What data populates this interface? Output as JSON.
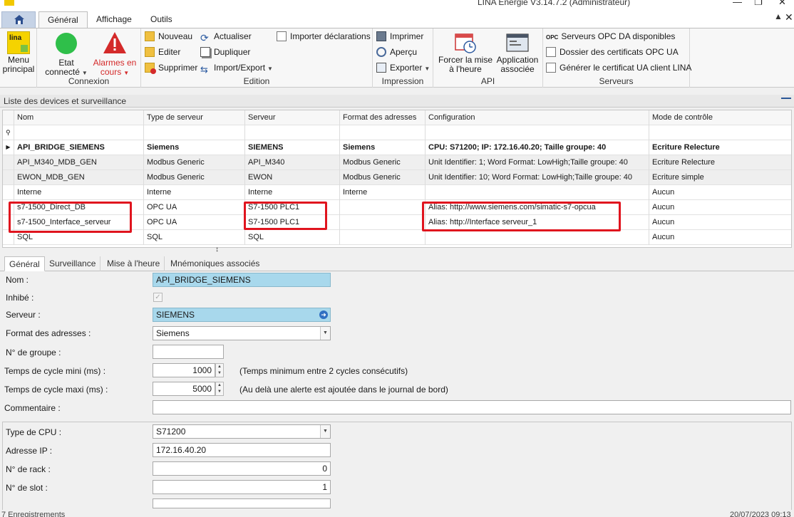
{
  "window": {
    "title": "LINA Energie   V3.14.7.2  (Administrateur)"
  },
  "ribbon_tabs": [
    "Général",
    "Affichage",
    "Outils"
  ],
  "ribbon": {
    "menu": {
      "line1": "Menu",
      "line2": "principal",
      "logo_text": "lina"
    },
    "connexion": {
      "label": "Connexion",
      "etat": {
        "line1": "Etat",
        "line2": "connecté"
      },
      "alarmes": {
        "line1": "Alarmes en",
        "line2": "cours"
      }
    },
    "edition": {
      "label": "Edition",
      "nouveau": "Nouveau",
      "editer": "Editer",
      "supprimer": "Supprimer",
      "actualiser": "Actualiser",
      "dupliquer": "Dupliquer",
      "import_export": "Import/Export",
      "importer": "Importer déclarations"
    },
    "impression": {
      "label": "Impression",
      "imprimer": "Imprimer",
      "apercu": "Aperçu",
      "exporter": "Exporter"
    },
    "api": {
      "label": "API",
      "forcer": {
        "line1": "Forcer la mise",
        "line2": "à l'heure"
      },
      "application": {
        "line1": "Application",
        "line2": "associée"
      }
    },
    "serveurs": {
      "label": "Serveurs",
      "opc_badge": "OPC",
      "opc_da": "Serveurs OPC DA disponibles",
      "dossier": "Dossier des certificats OPC UA",
      "generer": "Générer le certificat UA client LINA"
    }
  },
  "devices": {
    "section_title": "Liste des devices et surveillance",
    "columns": [
      "Nom",
      "Type de serveur",
      "Serveur",
      "Format des adresses",
      "Configuration",
      "Mode de contrôle"
    ],
    "rows": [
      [
        "API_BRIDGE_SIEMENS",
        "Siemens",
        "SIEMENS",
        "Siemens",
        "CPU: S71200; IP: 172.16.40.20; Taille groupe: 40",
        "Ecriture Relecture"
      ],
      [
        "API_M340_MDB_GEN",
        "Modbus Generic",
        "API_M340",
        "Modbus Generic",
        "Unit Identifier: 1; Word Format: LowHigh;Taille groupe: 40",
        "Ecriture Relecture"
      ],
      [
        "EWON_MDB_GEN",
        "Modbus Generic",
        "EWON",
        "Modbus Generic",
        "Unit Identifier: 10; Word Format: LowHigh;Taille groupe: 40",
        "Ecriture simple"
      ],
      [
        "Interne",
        "Interne",
        "Interne",
        "Interne",
        "",
        "Aucun"
      ],
      [
        "s7-1500_Direct_DB",
        "OPC UA",
        "S7-1500 PLC1",
        "",
        "Alias: http://www.siemens.com/simatic-s7-opcua",
        "Aucun"
      ],
      [
        "s7-1500_Interface_serveur",
        "OPC UA",
        "S7-1500 PLC1",
        "",
        "Alias: http://Interface serveur_1",
        "Aucun"
      ],
      [
        "SQL",
        "SQL",
        "SQL",
        "",
        "",
        "Aucun"
      ]
    ],
    "selected_row": 0
  },
  "detail_tabs": [
    "Général",
    "Surveillance",
    "Mise à l'heure",
    "Mnémoniques associés"
  ],
  "form": {
    "nom": {
      "label": "Nom :",
      "value": "API_BRIDGE_SIEMENS"
    },
    "inhibe": {
      "label": "Inhibé :",
      "checked": true
    },
    "serveur": {
      "label": "Serveur :",
      "value": "SIEMENS"
    },
    "format": {
      "label": "Format des adresses :",
      "value": "Siemens"
    },
    "groupe": {
      "label": "N° de groupe :",
      "value": ""
    },
    "cycle_mini": {
      "label": "Temps de cycle mini (ms) :",
      "value": "1000",
      "hint": "(Temps minimum entre 2 cycles consécutifs)"
    },
    "cycle_maxi": {
      "label": "Temps de cycle maxi (ms) :",
      "value": "5000",
      "hint": "(Au delà une alerte est ajoutée dans le journal de bord)"
    },
    "commentaire": {
      "label": "Commentaire :",
      "value": ""
    },
    "cpu": {
      "label": "Type de CPU :",
      "value": "S71200"
    },
    "ip": {
      "label": "Adresse IP :",
      "value": "172.16.40.20"
    },
    "rack": {
      "label": "N° de rack :",
      "value": "0"
    },
    "slot": {
      "label": "N° de slot :",
      "value": "1"
    }
  },
  "status": {
    "records": "7 Enregistrements",
    "datetime": "20/07/2023 09:13"
  },
  "colors": {
    "highlight_box": "#e0141e",
    "field_blue": "#a8d8ec",
    "alarm_red": "#d42a2a",
    "status_green": "#2fbf4a"
  }
}
